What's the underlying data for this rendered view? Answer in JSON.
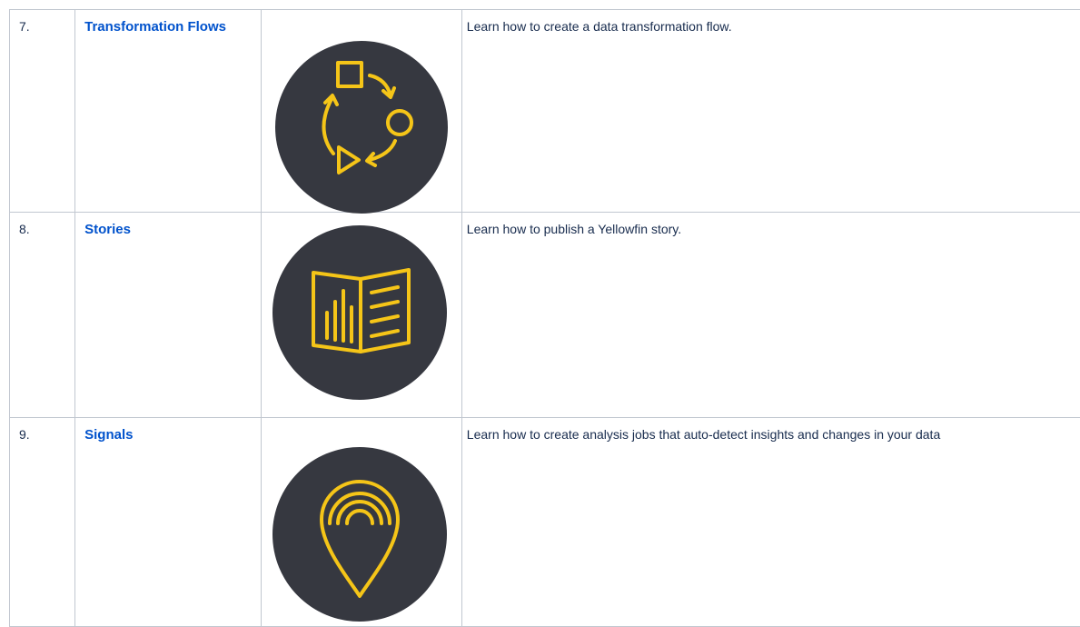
{
  "rows": [
    {
      "number": "7.",
      "title": "Transformation Flows",
      "icon": "transformation-flow-icon",
      "description": "Learn how to create a data transformation flow."
    },
    {
      "number": "8.",
      "title": "Stories",
      "icon": "story-book-icon",
      "description": "Learn how to publish a Yellowfin story."
    },
    {
      "number": "9.",
      "title": "Signals",
      "icon": "signal-pin-icon",
      "description": "Learn how to create analysis jobs that auto-detect insights and changes in your data"
    }
  ],
  "colors": {
    "icon_background": "#363840",
    "icon_stroke": "#f5c518",
    "link": "#0052cc",
    "border": "#c1c7d0"
  }
}
